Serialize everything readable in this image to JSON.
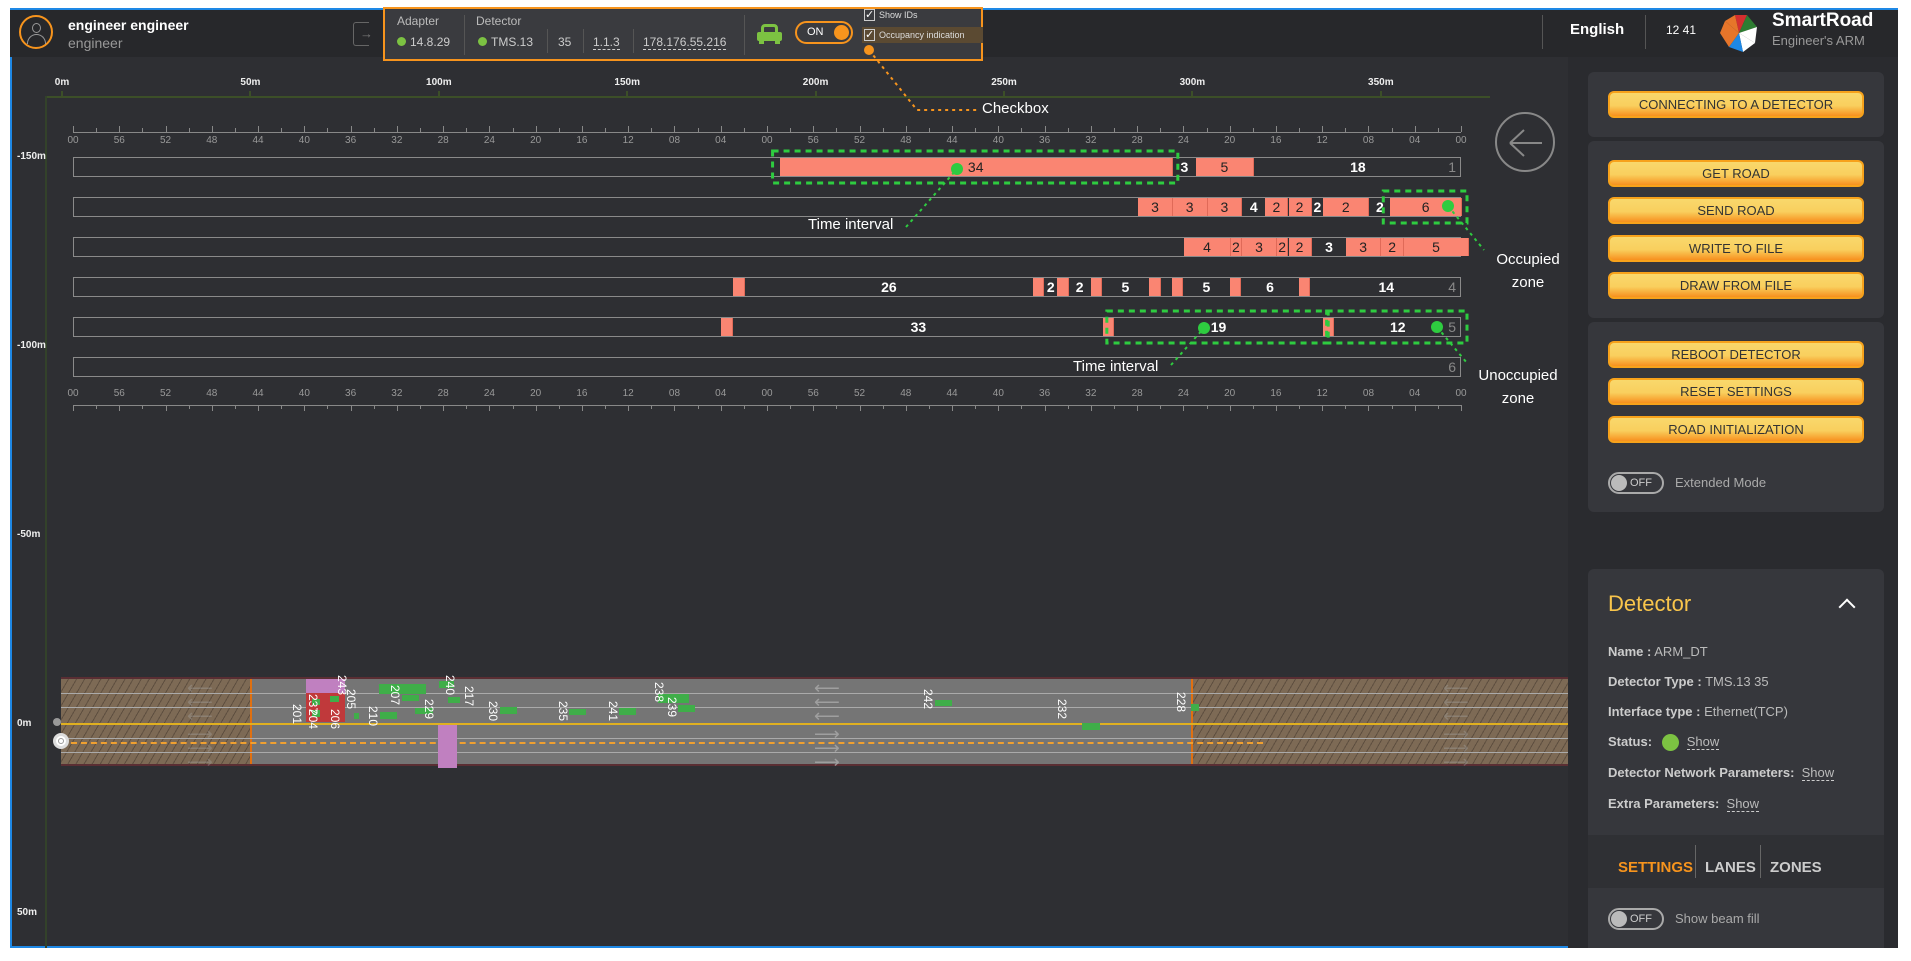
{
  "header": {
    "user_name": "engineer engineer",
    "user_role": "engineer",
    "adapter_label": "Adapter",
    "adapter_version": "14.8.29",
    "detector_label": "Detector",
    "detector_model": "TMS.13",
    "detector_num": "35",
    "detector_fw": "1.1.3",
    "detector_ip": "178.176.55.216",
    "vehicle_toggle": "ON",
    "show_ids_label": "Show IDs",
    "show_ids_checked": true,
    "occupancy_label": "Occupancy indication",
    "occupancy_checked": true,
    "language": "English",
    "time": "12 41",
    "brand": "SmartRoad",
    "brand_sub": "Engineer's ARM",
    "status_color": "#7cc242"
  },
  "annotations": {
    "checkbox": "Checkbox",
    "time_interval_1": "Time interval",
    "time_interval_2": "Time interval",
    "occupied_zone_1": "Occupied",
    "occupied_zone_2": "zone",
    "unoccupied_zone_1": "Unoccupied",
    "unoccupied_zone_2": "zone"
  },
  "chart_data": {
    "type": "timeline",
    "x_meter_ticks": [
      "0m",
      "50m",
      "100m",
      "150m",
      "200m",
      "250m",
      "300m",
      "350m"
    ],
    "y_meter_ticks": [
      "-150m",
      "-100m",
      "-50m",
      "0m",
      "50m"
    ],
    "time_ticks": [
      "00",
      "56",
      "52",
      "48",
      "44",
      "40",
      "36",
      "32",
      "28",
      "24",
      "20",
      "16",
      "12",
      "08",
      "04",
      "00",
      "56",
      "52",
      "48",
      "44",
      "40",
      "36",
      "32",
      "28",
      "24",
      "20",
      "16",
      "12",
      "08",
      "04",
      "00"
    ],
    "time_window_seconds": 120,
    "colors": {
      "occupied": "#fa8572",
      "free": "#2e2f33",
      "highlight": "#2ecc40"
    },
    "lanes": [
      {
        "lane": "1",
        "segments": [
          {
            "from": 59,
            "to": 25,
            "state": "occupied",
            "label": "34",
            "highlight": true
          },
          {
            "from": 25,
            "to": 23,
            "state": "free",
            "label": "3"
          },
          {
            "from": 23,
            "to": 18,
            "state": "occupied",
            "label": "5"
          },
          {
            "from": 18,
            "to": 0,
            "state": "free",
            "label": "18"
          }
        ]
      },
      {
        "lane": "2",
        "segments": [
          {
            "from": 28,
            "to": 25,
            "state": "occupied",
            "label": "3"
          },
          {
            "from": 25,
            "to": 22,
            "state": "occupied",
            "label": "3"
          },
          {
            "from": 22,
            "to": 19,
            "state": "occupied",
            "label": "3"
          },
          {
            "from": 19,
            "to": 17,
            "state": "free",
            "label": "4"
          },
          {
            "from": 17,
            "to": 15,
            "state": "occupied",
            "label": "2"
          },
          {
            "from": 15,
            "to": 13,
            "state": "occupied",
            "label": "2"
          },
          {
            "from": 13,
            "to": 12,
            "state": "free",
            "label": "2"
          },
          {
            "from": 12,
            "to": 8,
            "state": "occupied",
            "label": "2"
          },
          {
            "from": 8,
            "to": 6.2,
            "state": "free",
            "label": "2"
          },
          {
            "from": 6.2,
            "to": 0,
            "state": "occupied",
            "label": "6",
            "highlight": true
          }
        ]
      },
      {
        "lane": "3",
        "segments": [
          {
            "from": 24,
            "to": 20,
            "state": "occupied",
            "label": "4"
          },
          {
            "from": 20,
            "to": 19,
            "state": "occupied",
            "label": "2"
          },
          {
            "from": 19,
            "to": 16,
            "state": "occupied",
            "label": "3"
          },
          {
            "from": 16,
            "to": 15,
            "state": "occupied",
            "label": "2"
          },
          {
            "from": 15,
            "to": 13,
            "state": "occupied",
            "label": "2"
          },
          {
            "from": 13,
            "to": 10,
            "state": "free",
            "label": "3"
          },
          {
            "from": 10,
            "to": 7,
            "state": "occupied",
            "label": "3"
          },
          {
            "from": 7,
            "to": 5,
            "state": "occupied",
            "label": "2"
          },
          {
            "from": 5,
            "to": -0.6,
            "state": "occupied",
            "label": "5"
          }
        ]
      },
      {
        "lane": "4",
        "segments": [
          {
            "from": 63,
            "to": 62,
            "state": "occupied",
            "label": ""
          },
          {
            "from": 62,
            "to": 37.1,
            "state": "free",
            "label": "26"
          },
          {
            "from": 37.1,
            "to": 36.1,
            "state": "occupied",
            "label": ""
          },
          {
            "from": 36.1,
            "to": 35,
            "state": "free",
            "label": "2"
          },
          {
            "from": 35,
            "to": 34,
            "state": "occupied",
            "label": ""
          },
          {
            "from": 34,
            "to": 32.1,
            "state": "free",
            "label": "2"
          },
          {
            "from": 32.1,
            "to": 31.1,
            "state": "occupied",
            "label": ""
          },
          {
            "from": 31.1,
            "to": 27.1,
            "state": "free",
            "label": "5"
          },
          {
            "from": 27.1,
            "to": 26,
            "state": "occupied",
            "label": ""
          },
          {
            "from": 26,
            "to": 25.1,
            "state": "free",
            "label": ""
          },
          {
            "from": 25.1,
            "to": 24.1,
            "state": "occupied",
            "label": ""
          },
          {
            "from": 24.1,
            "to": 20.1,
            "state": "free",
            "label": "5"
          },
          {
            "from": 20.1,
            "to": 19.1,
            "state": "occupied",
            "label": ""
          },
          {
            "from": 19.1,
            "to": 14.1,
            "state": "free",
            "label": "6"
          },
          {
            "from": 14.1,
            "to": 13.1,
            "state": "occupied",
            "label": ""
          },
          {
            "from": 13.1,
            "to": 0,
            "state": "free",
            "label": "14"
          }
        ]
      },
      {
        "lane": "5",
        "segments": [
          {
            "from": 64.1,
            "to": 63,
            "state": "occupied",
            "label": ""
          },
          {
            "from": 63,
            "to": 31,
            "state": "free",
            "label": "33"
          },
          {
            "from": 31,
            "to": 30.1,
            "state": "occupied",
            "label": ""
          },
          {
            "from": 30.1,
            "to": 12,
            "state": "free",
            "label": "19",
            "highlight": true
          },
          {
            "from": 12,
            "to": 11.1,
            "state": "occupied",
            "label": ""
          },
          {
            "from": 11.1,
            "to": 0,
            "state": "free",
            "label": "12",
            "highlight": true
          }
        ]
      },
      {
        "lane": "6",
        "segments": []
      }
    ]
  },
  "road": {
    "vehicles": [
      "243",
      "205",
      "237",
      "204",
      "201",
      "206",
      "210",
      "207",
      "229",
      "240",
      "217",
      "230",
      "235",
      "241",
      "238",
      "239",
      "242",
      "232",
      "228"
    ]
  },
  "sidebar": {
    "buttons": [
      "CONNECTING TO A DETECTOR",
      "GET ROAD",
      "SEND ROAD",
      "WRITE TO FILE",
      "DRAW FROM FILE",
      "REBOOT DETECTOR",
      "RESET SETTINGS",
      "ROAD INITIALIZATION"
    ],
    "extended_mode_toggle": "OFF",
    "extended_mode_label": "Extended Mode",
    "detector": {
      "title": "Detector",
      "name_label": "Name :",
      "name": "ARM_DT",
      "type_label": "Detector Type :",
      "type": "TMS.13 35",
      "iface_label": "Interface type :",
      "iface": "Ethernet(TCP)",
      "status_label": "Status:",
      "status_link": "Show",
      "net_label": "Detector Network Parameters:",
      "net_link": "Show",
      "extra_label": "Extra Parameters:",
      "extra_link": "Show"
    },
    "tabs": [
      "SETTINGS",
      "LANES",
      "ZONES"
    ],
    "active_tab": "SETTINGS",
    "beam_toggle": "OFF",
    "beam_label": "Show beam fill",
    "accent": "#f7941d"
  }
}
